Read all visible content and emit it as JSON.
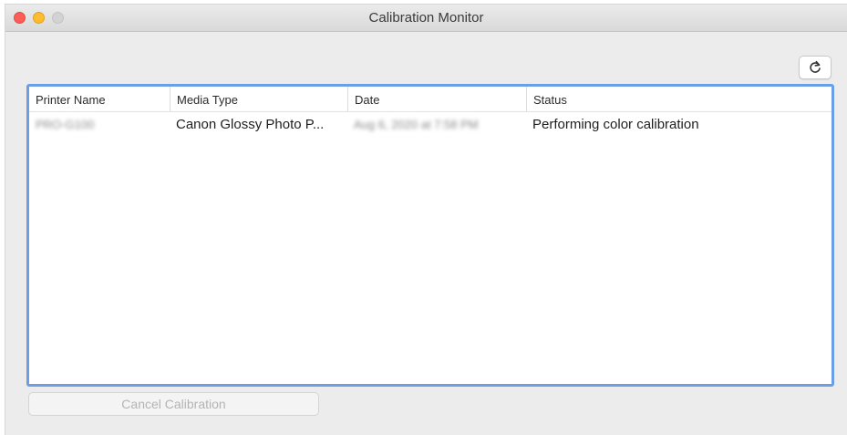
{
  "window": {
    "title": "Calibration Monitor"
  },
  "toolbar": {
    "refresh_icon": "refresh-icon"
  },
  "table": {
    "columns": [
      "Printer Name",
      "Media Type",
      "Date",
      "Status"
    ],
    "rows": [
      {
        "printer_name": "PRO-G100",
        "media_type": "Canon Glossy Photo P...",
        "date": "Aug 6, 2020 at 7:58 PM",
        "status": "Performing color calibration"
      }
    ]
  },
  "actions": {
    "cancel_label": "Cancel Calibration"
  },
  "colors": {
    "focus_ring": "#6a9fe8",
    "close": "#fd5d57",
    "minimize": "#febc2e"
  }
}
